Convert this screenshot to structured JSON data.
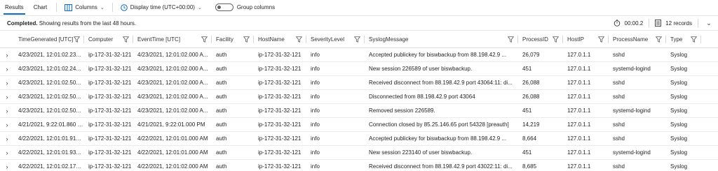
{
  "toolbar": {
    "tabs": [
      {
        "label": "Results",
        "active": true
      },
      {
        "label": "Chart",
        "active": false
      }
    ],
    "columns_label": "Columns",
    "display_time_label": "Display time (UTC+00:00)",
    "group_columns_label": "Group columns",
    "group_columns_enabled": false
  },
  "status": {
    "completed": "Completed.",
    "message": "Showing results from the last 48 hours.",
    "duration": "00:00.2",
    "records": "12 records"
  },
  "table": {
    "headers": [
      "TimeGenerated [UTC]",
      "Computer",
      "EventTime [UTC]",
      "Facility",
      "HostName",
      "SeverityLevel",
      "SyslogMessage",
      "ProcessID",
      "HostIP",
      "ProcessName",
      "Type"
    ],
    "rows": [
      [
        "4/23/2021, 12:01:02.233 A...",
        "ip-172-31-32-121",
        "4/23/2021, 12:01:02.000 A...",
        "auth",
        "ip-172-31-32-121",
        "info",
        "Accepted publickey for biswbackup from 88.198.42.9 ...",
        "26,079",
        "127.0.1.1",
        "sshd",
        "Syslog"
      ],
      [
        "4/23/2021, 12:01:02.243 A...",
        "ip-172-31-32-121",
        "4/23/2021, 12:01:02.000 A...",
        "auth",
        "ip-172-31-32-121",
        "info",
        "New session 226589 of user biswbackup.",
        "451",
        "127.0.1.1",
        "systemd-logind",
        "Syslog"
      ],
      [
        "4/23/2021, 12:01:02.500 A...",
        "ip-172-31-32-121",
        "4/23/2021, 12:01:02.000 A...",
        "auth",
        "ip-172-31-32-121",
        "info",
        "Received disconnect from 88.198.42.9 port 43064:11: di...",
        "26,088",
        "127.0.1.1",
        "sshd",
        "Syslog"
      ],
      [
        "4/23/2021, 12:01:02.500 A...",
        "ip-172-31-32-121",
        "4/23/2021, 12:01:02.000 A...",
        "auth",
        "ip-172-31-32-121",
        "info",
        "Disconnected from 88.198.42.9 port 43064",
        "26,088",
        "127.0.1.1",
        "sshd",
        "Syslog"
      ],
      [
        "4/23/2021, 12:01:02.503 A...",
        "ip-172-31-32-121",
        "4/23/2021, 12:01:02.000 A...",
        "auth",
        "ip-172-31-32-121",
        "info",
        "Removed session 226589.",
        "451",
        "127.0.1.1",
        "systemd-logind",
        "Syslog"
      ],
      [
        "4/21/2021, 9:22:01.860 PM",
        "ip-172-31-32-121",
        "4/21/2021, 9:22:01.000 PM",
        "auth",
        "ip-172-31-32-121",
        "info",
        "Connection closed by 85.25.146.65 port 54328 [preauth]",
        "14,219",
        "127.0.1.1",
        "sshd",
        "Syslog"
      ],
      [
        "4/22/2021, 12:01:01.910 AM",
        "ip-172-31-32-121",
        "4/22/2021, 12:01:01.000 AM",
        "auth",
        "ip-172-31-32-121",
        "info",
        "Accepted publickey for biswbackup from 88.198.42.9 ...",
        "8,664",
        "127.0.1.1",
        "sshd",
        "Syslog"
      ],
      [
        "4/22/2021, 12:01:01.937 AM",
        "ip-172-31-32-121",
        "4/22/2021, 12:01:01.000 AM",
        "auth",
        "ip-172-31-32-121",
        "info",
        "New session 223140 of user biswbackup.",
        "451",
        "127.0.1.1",
        "systemd-logind",
        "Syslog"
      ],
      [
        "4/22/2021, 12:01:02.170 AM",
        "ip-172-31-32-121",
        "4/22/2021, 12:01:02.000 AM",
        "auth",
        "ip-172-31-32-121",
        "info",
        "Received disconnect from 88.198.42.9 port 43022:11: di...",
        "8,685",
        "127.0.1.1",
        "sshd",
        "Syslog"
      ]
    ]
  },
  "icons": {
    "columns": "columns-icon",
    "clock": "clock-icon",
    "timer": "timer-icon",
    "records": "records-icon",
    "filter": "filter-icon",
    "expander": "chevron-right-icon",
    "expand_all": "expand-icon"
  },
  "colors": {
    "accent": "#0f6cbd",
    "icon": "#0f6cbd"
  }
}
